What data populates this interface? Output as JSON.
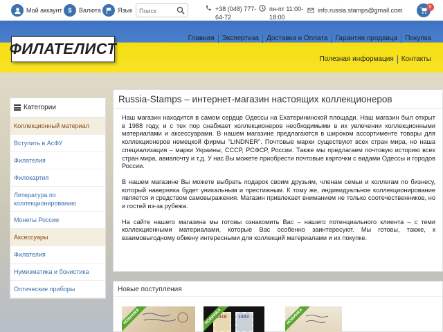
{
  "topbar": {
    "account_label": "Мой аккаунт",
    "currency_label": "Валюта",
    "currency_symbol": "$",
    "language_label": "Язык",
    "search_placeholder": "Поиск",
    "phone": "+38 (048) 777-64-72",
    "hours": "пн-пт 11:00-18:00",
    "email": "info.russia.stamps@gmail.com",
    "cart_count": "0"
  },
  "header": {
    "logo": "ФИЛАТЕЛИСТ",
    "nav_primary": [
      "Главная",
      "Экспертиза",
      "Доставка и Оплата",
      "Гарантия продавца",
      "Покупка"
    ],
    "nav_secondary": [
      "Полезная информация",
      "Контакты"
    ]
  },
  "sidebar": {
    "title": "Категории",
    "items": [
      "Коллекционный материал",
      "Вступить в АсФУ",
      "Филателия",
      "Филокартия",
      "Литература по коллекционированию",
      "Монеты России",
      "Аксессуары",
      "Филателия",
      "Нумизматика и бонистика",
      "Оптические приборы"
    ]
  },
  "main": {
    "title": "Russia-Stamps – интернет-магазин настоящих коллекционеров",
    "paragraphs": [
      "Наш магазин находится в самом сердце Одессы на Екатерининской площади. Наш магазин был открыт в 1988 году, и с тех пор снабжает коллекционеров необходимыми в их увлечении коллекционными материалами и аксессуарами. В нашем магазине предлагаются в широком ассортименте товары для коллекционеров немецкой фирмы \"LINDNER\". Почтовые марки существуют всех стран мира, но наша специализация – марки Украины, СССР, РСФСР, России. Также мы предлагаем почтовую историю всех стран мира, авиапочту и т.д. У нас Вы можете приобрести почтовые карточки с видами Одессы и городов России.",
      "В нашем магазине Вы можете выбрать подарок своим друзьям, членам семьи и коллегам по бизнесу, который наверняка будет уникальным и престижным. К тому же, индивидуальное коллекционирование является и средством самовыражения. Магазин привлекает вниманием не только соотечественников, но и гостей из-за рубежа.",
      "На сайте нашего магазина мы готовы ознакомить Вас – нашего потенциального клиента – с теми коллекционными материалами, которые Вас особенно заинтересуют. Мы готовы, также, к взаимовыгодному обмену интересными для коллекций материалами и их покупке."
    ]
  },
  "arrivals": {
    "title": "Новые поступления",
    "badge": "НОВИНКА",
    "thumb_texts": [
      "1918",
      "1933"
    ]
  },
  "colors": {
    "flag_blue": "#3d73c3",
    "flag_yellow": "#f6df12",
    "link": "#3a72b0",
    "badge_green": "#5aa52e"
  }
}
